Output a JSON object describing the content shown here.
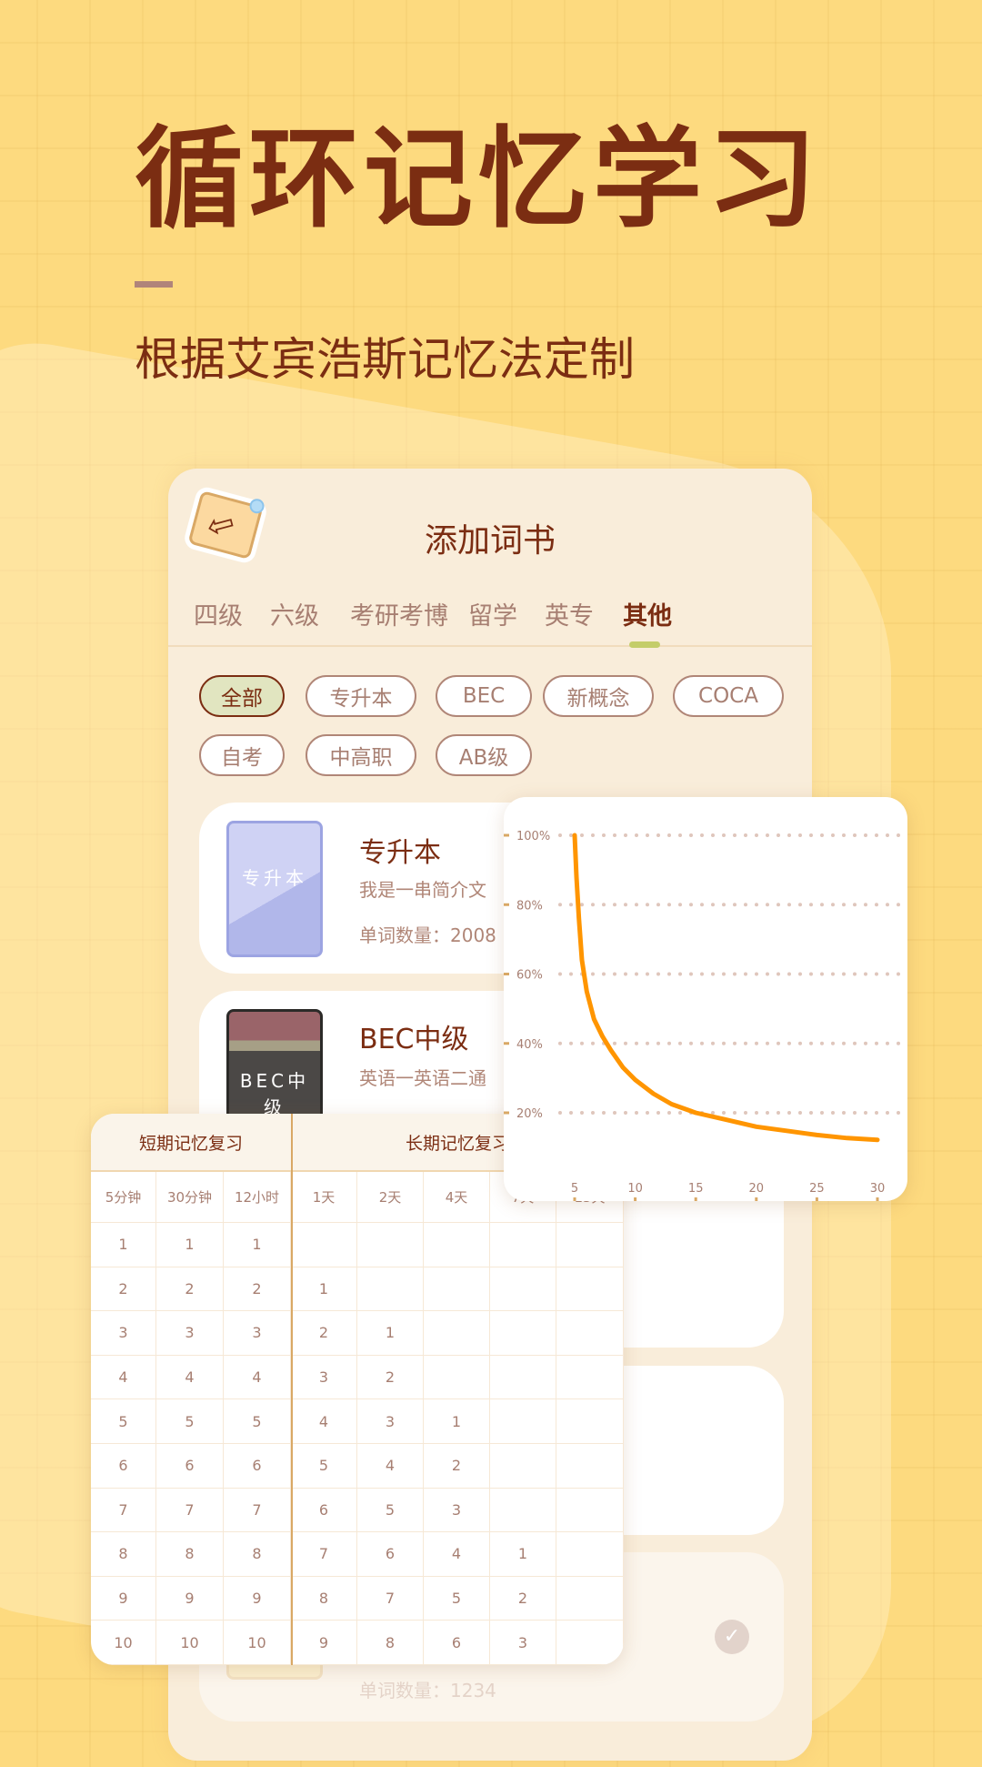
{
  "headline": "循环记忆学习",
  "subheadline": "根据艾宾浩斯记忆法定制",
  "panel": {
    "title": "添加词书",
    "tabs": [
      "四级",
      "六级",
      "考研考博",
      "留学",
      "英专",
      "其他"
    ],
    "active_tab": "其他",
    "chips": [
      "全部",
      "专升本",
      "BEC",
      "新概念",
      "COCA",
      "自考",
      "中高职",
      "AB级"
    ],
    "active_chip": "全部",
    "books": [
      {
        "name": "专升本",
        "cover_label": "专升本",
        "desc": "我是一串简介文",
        "count": "单词数量：2008",
        "cover_color": "#b1b7ea"
      },
      {
        "name": "BEC中级",
        "cover_label": "BEC中级",
        "desc": "英语一英语二通",
        "count": "",
        "cover_color": "#4b4846"
      },
      {
        "name": "",
        "desc": "",
        "count": ""
      },
      {
        "name": "",
        "desc": "",
        "count": "单词数量：1234",
        "selected": true
      }
    ]
  },
  "review_table": {
    "groups": [
      "短期记忆复习",
      "长期记忆复习"
    ],
    "columns": [
      "5分钟",
      "30分钟",
      "12小时",
      "1天",
      "2天",
      "4天",
      "7天",
      "15天"
    ],
    "rows": [
      [
        "1",
        "1",
        "1",
        "",
        "",
        "",
        "",
        ""
      ],
      [
        "2",
        "2",
        "2",
        "1",
        "",
        "",
        "",
        ""
      ],
      [
        "3",
        "3",
        "3",
        "2",
        "1",
        "",
        "",
        ""
      ],
      [
        "4",
        "4",
        "4",
        "3",
        "2",
        "",
        "",
        ""
      ],
      [
        "5",
        "5",
        "5",
        "4",
        "3",
        "1",
        "",
        ""
      ],
      [
        "6",
        "6",
        "6",
        "5",
        "4",
        "2",
        "",
        ""
      ],
      [
        "7",
        "7",
        "7",
        "6",
        "5",
        "3",
        "",
        ""
      ],
      [
        "8",
        "8",
        "8",
        "7",
        "6",
        "4",
        "1",
        ""
      ],
      [
        "9",
        "9",
        "9",
        "8",
        "7",
        "5",
        "2",
        ""
      ],
      [
        "10",
        "10",
        "10",
        "9",
        "8",
        "6",
        "3",
        ""
      ]
    ]
  },
  "chart_data": {
    "type": "line",
    "x": [
      5,
      5.15,
      5.35,
      5.6,
      6,
      6.6,
      7.3,
      8,
      9,
      10,
      11.5,
      13,
      15,
      17.5,
      20,
      22.5,
      25,
      27.5,
      30
    ],
    "y": [
      100,
      88,
      76,
      64,
      55,
      47,
      42,
      38,
      33,
      29.5,
      25.5,
      22.5,
      20,
      18,
      16,
      14.8,
      13.6,
      12.7,
      12.2
    ],
    "xticks": [
      "5",
      "10",
      "15",
      "20",
      "25",
      "30"
    ],
    "yticks": [
      "20%",
      "40%",
      "60%",
      "80%",
      "100%"
    ],
    "xlim": [
      5,
      30
    ],
    "ylim": [
      20,
      100
    ],
    "grid": "horizontal dotted",
    "line_color": "#ff9500"
  }
}
